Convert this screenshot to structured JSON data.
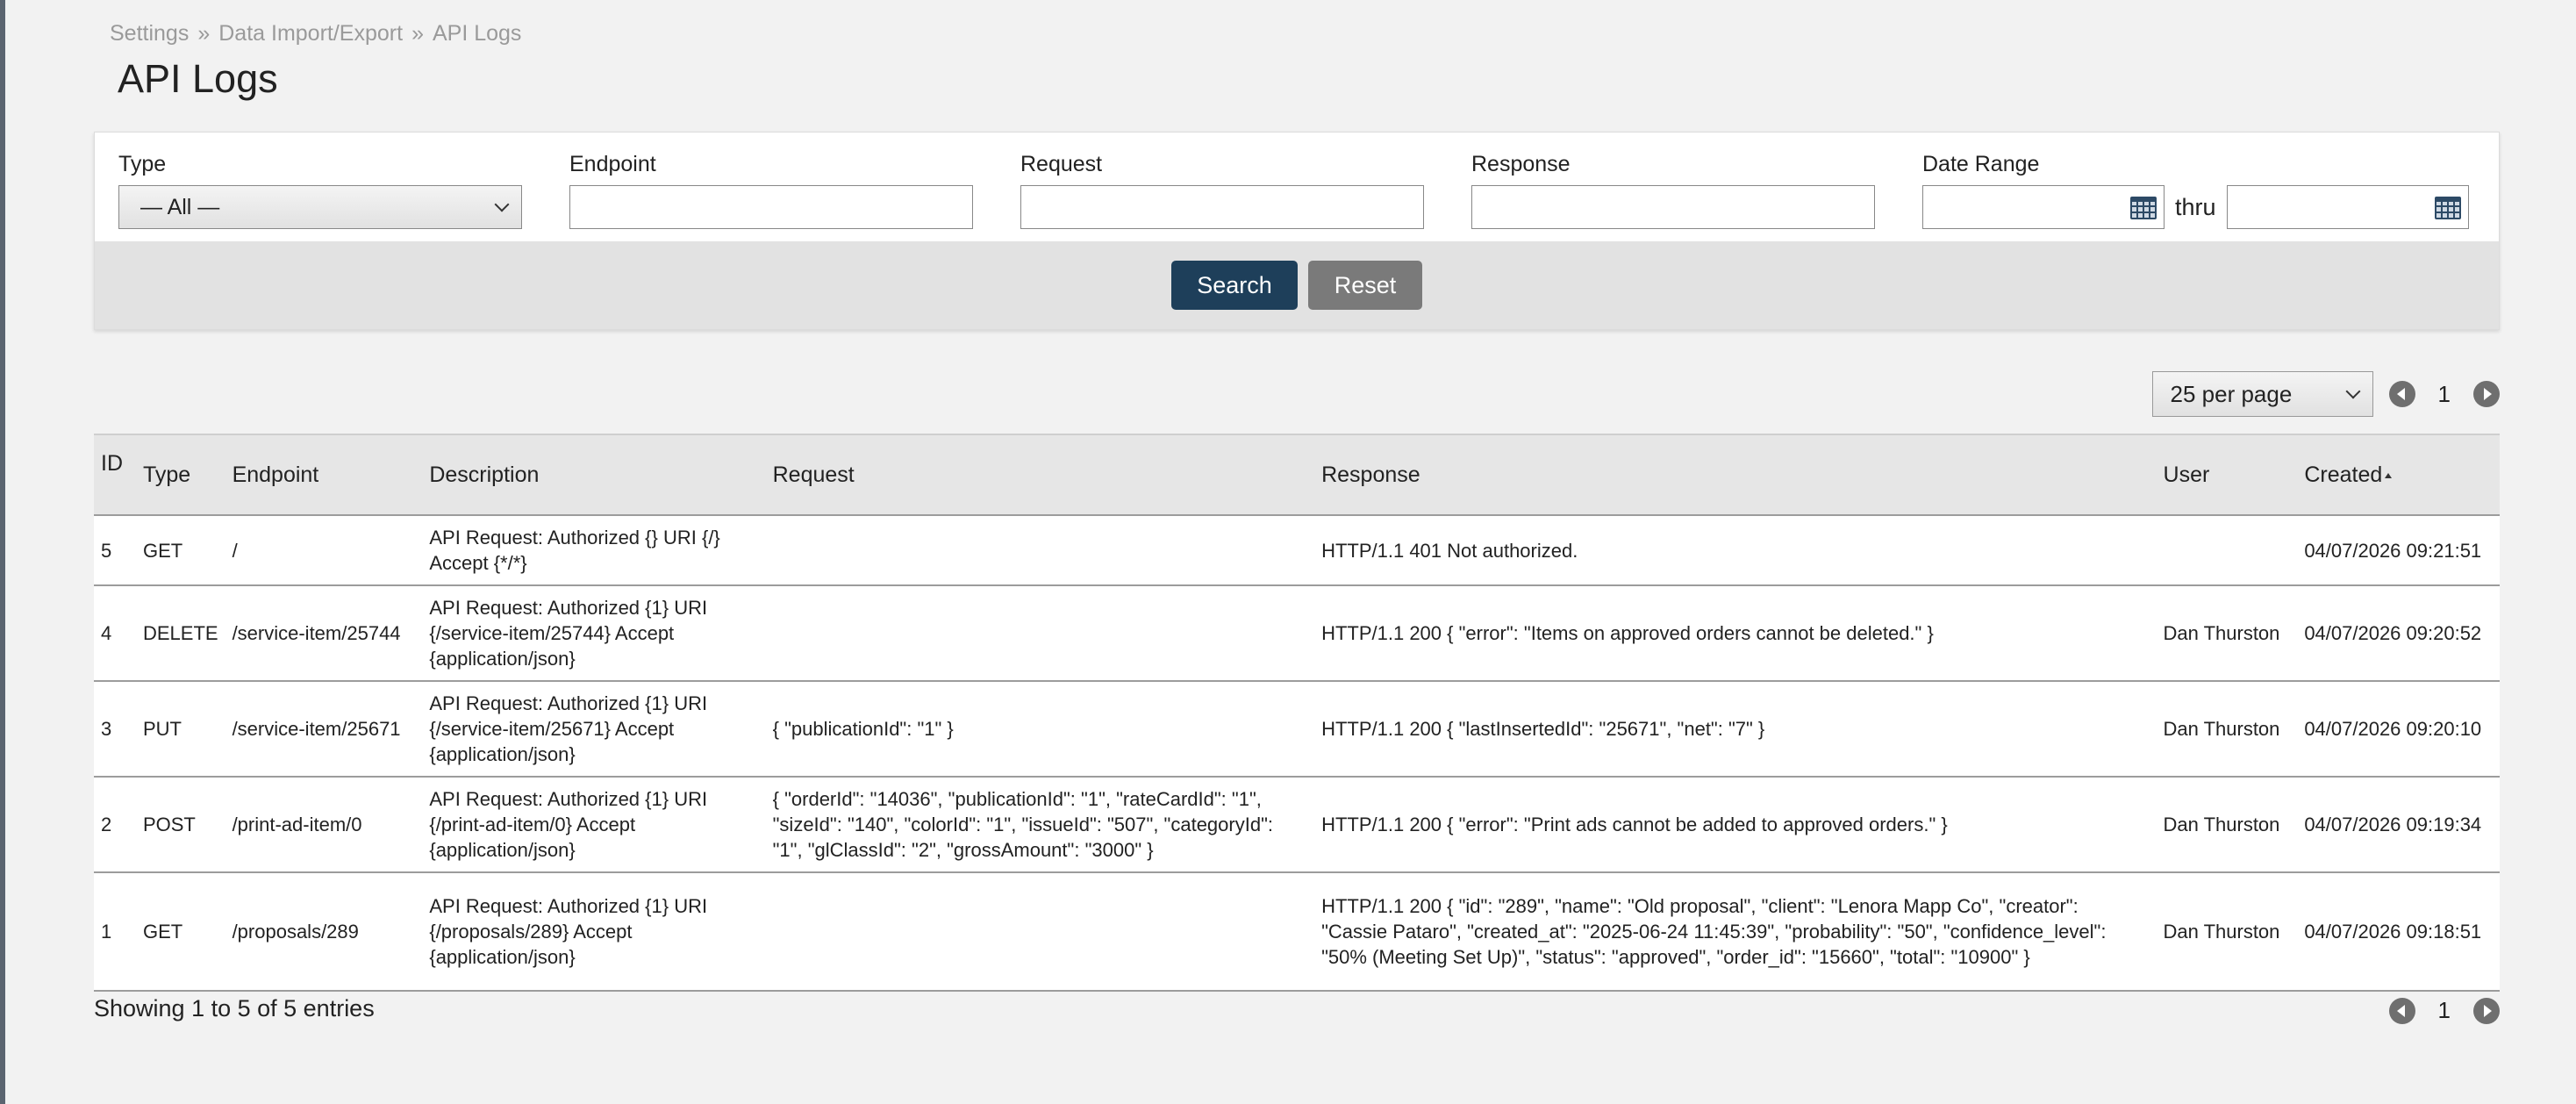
{
  "breadcrumb": {
    "items": [
      "Settings",
      "Data Import/Export",
      "API Logs"
    ],
    "separator": "»"
  },
  "page_title": "API Logs",
  "filters": {
    "type": {
      "label": "Type",
      "value": "— All —"
    },
    "endpoint": {
      "label": "Endpoint",
      "value": ""
    },
    "request": {
      "label": "Request",
      "value": ""
    },
    "response": {
      "label": "Response",
      "value": ""
    },
    "date_range": {
      "label": "Date Range",
      "from": "",
      "to": "",
      "thru_label": "thru"
    },
    "search_label": "Search",
    "reset_label": "Reset"
  },
  "pagination": {
    "per_page": "25 per page",
    "current_page": "1"
  },
  "table": {
    "headers": [
      "ID",
      "Type",
      "Endpoint",
      "Description",
      "Request",
      "Response",
      "User",
      "Created"
    ],
    "sorted_by": "Created",
    "rows": [
      {
        "id": "5",
        "type": "GET",
        "endpoint": "/",
        "description": "API Request: Authorized {} URI {/} Accept {*/*}",
        "request": "",
        "response": "HTTP/1.1 401 Not authorized.",
        "user": "",
        "created": "04/07/2026 09:21:51"
      },
      {
        "id": "4",
        "type": "DELETE",
        "endpoint": "/service-item/25744",
        "description": "API Request: Authorized {1} URI {/service-item/25744} Accept {application/json}",
        "request": "",
        "response": "HTTP/1.1 200 { \"error\": \"Items on approved orders cannot be deleted.\" }",
        "user": "Dan Thurston",
        "created": "04/07/2026 09:20:52"
      },
      {
        "id": "3",
        "type": "PUT",
        "endpoint": "/service-item/25671",
        "description": "API Request: Authorized {1} URI {/service-item/25671} Accept {application/json}",
        "request": "{ \"publicationId\": \"1\" }",
        "response": "HTTP/1.1 200 { \"lastInsertedId\": \"25671\", \"net\": \"7\" }",
        "user": "Dan Thurston",
        "created": "04/07/2026 09:20:10"
      },
      {
        "id": "2",
        "type": "POST",
        "endpoint": "/print-ad-item/0",
        "description": "API Request: Authorized {1} URI {/print-ad-item/0} Accept {application/json}",
        "request": "{ \"orderId\": \"14036\", \"publicationId\": \"1\", \"rateCardId\": \"1\", \"sizeId\": \"140\", \"colorId\": \"1\", \"issueId\": \"507\", \"categoryId\": \"1\", \"glClassId\": \"2\", \"grossAmount\": \"3000\" }",
        "response": "HTTP/1.1 200 { \"error\": \"Print ads cannot be added to approved orders.\" }",
        "user": "Dan Thurston",
        "created": "04/07/2026 09:19:34"
      },
      {
        "id": "1",
        "type": "GET",
        "endpoint": "/proposals/289",
        "description": "API Request: Authorized {1} URI {/proposals/289} Accept {application/json}",
        "request": "",
        "response": "HTTP/1.1 200 { \"id\": \"289\", \"name\": \"Old proposal\", \"client\": \"Lenora Mapp Co\", \"creator\": \"Cassie Pataro\", \"created_at\": \"2025-06-24 11:45:39\", \"probability\": \"50\", \"confidence_level\": \"50% (Meeting Set Up)\", \"status\": \"approved\", \"order_id\": \"15660\", \"total\": \"10900\" }",
        "user": "Dan Thurston",
        "created": "04/07/2026 09:18:51"
      }
    ]
  },
  "footer": {
    "info": "Showing 1 to 5 of 5 entries"
  },
  "colors": {
    "primary_button": "#1e3f5a",
    "secondary_button": "#7a7a7a",
    "calendar_icon": "#2d4a66"
  }
}
